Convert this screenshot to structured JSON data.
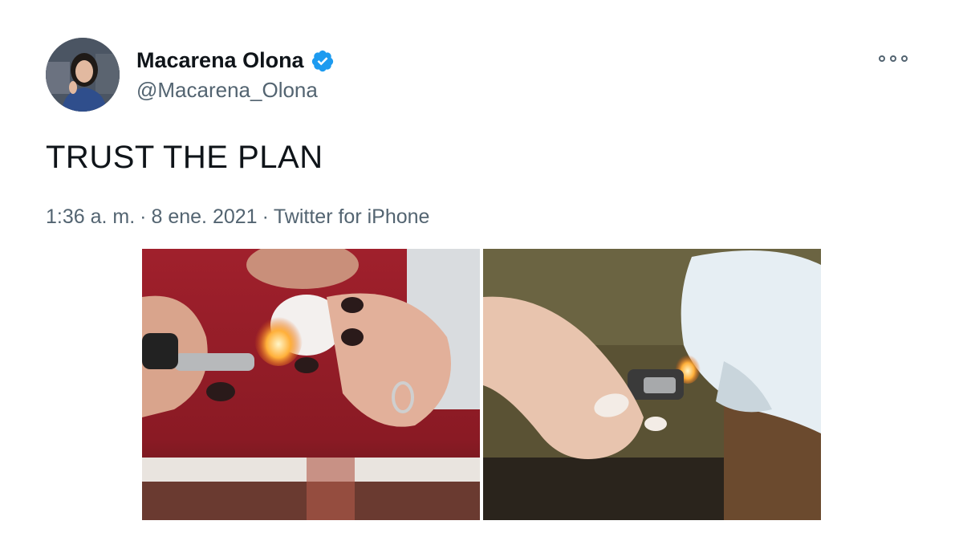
{
  "tweet": {
    "author": {
      "display_name": "Macarena Olona",
      "handle": "@Macarena_Olona",
      "verified": true
    },
    "text": "TRUST THE PLAN",
    "time": "1:36 a. m.",
    "separator": "·",
    "date": "8 ene. 2021",
    "source": "Twitter for iPhone",
    "media": [
      {
        "icon": "photo-lighter-burning-cotton-red-sweater"
      },
      {
        "icon": "photo-lighter-burning-cloth-olive-sweater"
      }
    ]
  },
  "colors": {
    "text_primary": "#0f1419",
    "text_secondary": "#536471",
    "verified_blue": "#1d9bf0"
  }
}
